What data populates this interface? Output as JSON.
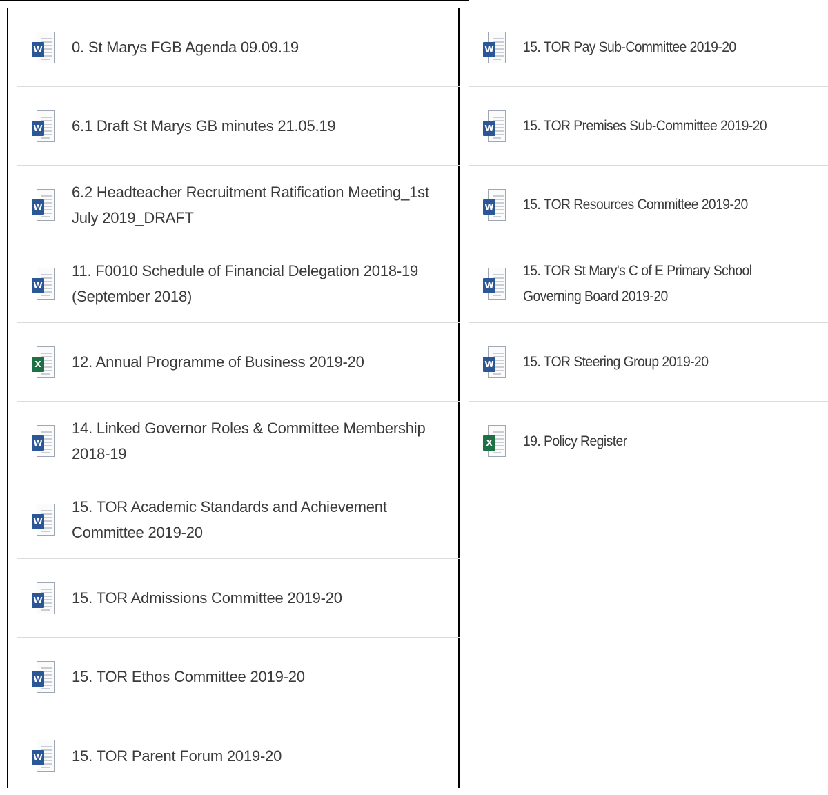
{
  "colors": {
    "word_icon": "#2b5797",
    "excel_icon": "#1e7145",
    "divider": "#dcdcdc",
    "text": "#3a3a3a"
  },
  "left_column": {
    "files": [
      {
        "name": "0. St Marys FGB Agenda 09.09.19",
        "icon": "word-document-icon",
        "badge": "W"
      },
      {
        "name": "6.1 Draft St Marys GB minutes 21.05.19",
        "icon": "word-document-icon",
        "badge": "W"
      },
      {
        "name": "6.2 Headteacher Recruitment Ratification Meeting_1st July 2019_DRAFT",
        "icon": "word-document-icon",
        "badge": "W"
      },
      {
        "name": "11. F0010 Schedule of Financial Delegation 2018-19 (September 2018)",
        "icon": "word-document-icon",
        "badge": "W"
      },
      {
        "name": "12. Annual Programme of Business 2019-20",
        "icon": "excel-spreadsheet-icon",
        "badge": "X"
      },
      {
        "name": "14. Linked Governor Roles & Committee Membership 2018-19",
        "icon": "word-document-icon",
        "badge": "W"
      },
      {
        "name": "15. TOR Academic Standards and Achievement Committee 2019-20",
        "icon": "word-document-icon",
        "badge": "W"
      },
      {
        "name": "15. TOR Admissions Committee 2019-20",
        "icon": "word-document-icon",
        "badge": "W"
      },
      {
        "name": "15. TOR Ethos Committee 2019-20",
        "icon": "word-document-icon",
        "badge": "W"
      },
      {
        "name": "15. TOR Parent Forum 2019-20",
        "icon": "word-document-icon",
        "badge": "W"
      }
    ]
  },
  "right_column": {
    "files": [
      {
        "name": "15. TOR Pay Sub-Committee 2019-20",
        "icon": "word-document-icon",
        "badge": "W"
      },
      {
        "name": "15. TOR Premises Sub-Committee 2019-20",
        "icon": "word-document-icon",
        "badge": "W"
      },
      {
        "name": "15. TOR Resources Committee 2019-20",
        "icon": "word-document-icon",
        "badge": "W"
      },
      {
        "name": "15. TOR St Mary's C of E Primary School Governing Board 2019-20",
        "icon": "word-document-icon",
        "badge": "W"
      },
      {
        "name": "15. TOR Steering Group 2019-20",
        "icon": "word-document-icon",
        "badge": "W"
      },
      {
        "name": "19. Policy Register",
        "icon": "excel-spreadsheet-icon",
        "badge": "X"
      }
    ]
  }
}
